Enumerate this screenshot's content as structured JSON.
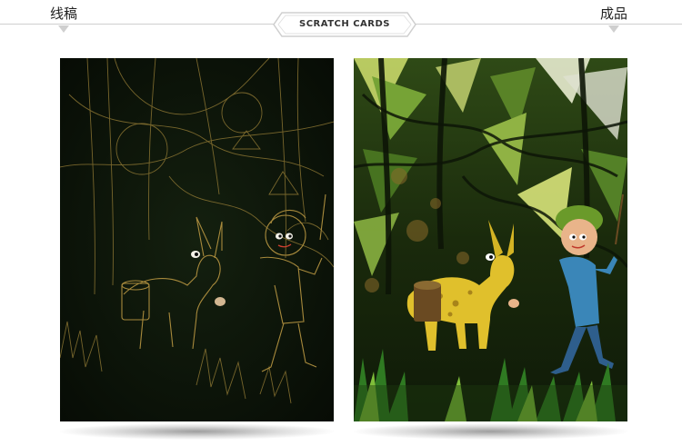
{
  "header": {
    "left_label": "线稿",
    "right_label": "成品",
    "badge": "SCRATCH CARDS"
  },
  "cards": [
    {
      "name": "line-art-card",
      "illustration": "gold-line-sketch-boy-leading-goat"
    },
    {
      "name": "finished-card",
      "illustration": "colored-boy-leading-yellow-goat"
    }
  ],
  "colors": {
    "gold_line": "#a88a3c",
    "left_bg": "#0a1108",
    "goat_yellow": "#e2c22e",
    "boy_shirt": "#3b86b8",
    "foliage_green": "#5f9a2a"
  }
}
